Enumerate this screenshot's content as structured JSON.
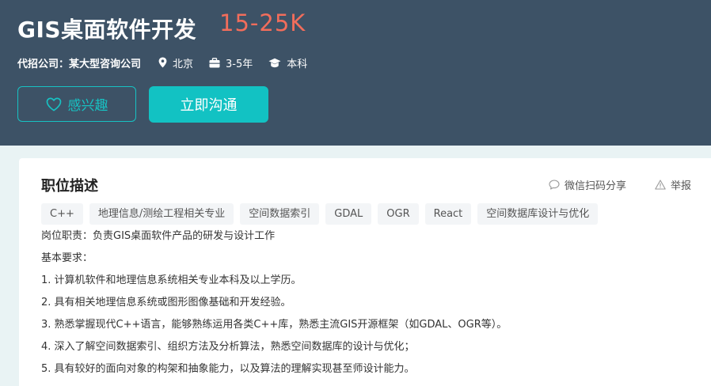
{
  "header": {
    "title": "GIS桌面软件开发",
    "salary": "15-25K",
    "company": "代招公司：某大型咨询公司",
    "location": "北京",
    "experience": "3-5年",
    "education": "本科",
    "interest_label": "感兴趣",
    "chat_label": "立即沟通"
  },
  "description": {
    "heading": "职位描述",
    "share_label": "微信扫码分享",
    "report_label": "举报",
    "tags": [
      "C++",
      "地理信息/测绘工程相关专业",
      "空间数据索引",
      "GDAL",
      "OGR",
      "React",
      "空间数据库设计与优化"
    ],
    "lines": [
      "岗位职责：负责GIS桌面软件产品的研发与设计工作",
      "基本要求：",
      "1. 计算机软件和地理信息系统相关专业本科及以上学历。",
      "2. 具有相关地理信息系统或图形图像基础和开发经验。",
      "3. 熟悉掌握现代C++语言，能够熟练运用各类C++库，熟悉主流GIS开源框架（如GDAL、OGR等）。",
      "4. 深入了解空间数据索引、组织方法及分析算法，熟悉空间数据库的设计与优化；",
      "5. 具有较好的面向对象的构架和抽象能力，以及算法的理解实现甚至师设计能力。"
    ]
  },
  "colors": {
    "header_bg": "#3d5266",
    "salary": "#f26d5b",
    "accent": "#12c2c3"
  },
  "icons": [
    "location-icon",
    "briefcase-icon",
    "graduation-cap-icon",
    "heart-icon",
    "chat-bubble-icon",
    "warning-icon"
  ]
}
